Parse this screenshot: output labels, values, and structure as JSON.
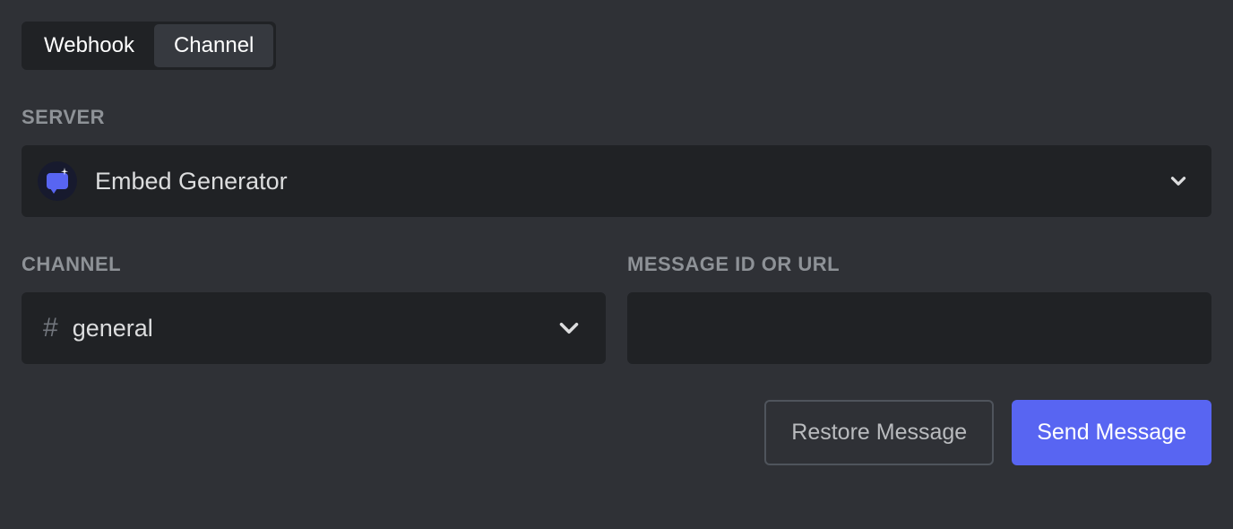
{
  "tabs": {
    "webhook": "Webhook",
    "channel": "Channel"
  },
  "server": {
    "label": "SERVER",
    "selected": "Embed Generator"
  },
  "channel": {
    "label": "CHANNEL",
    "selected": "general"
  },
  "messageId": {
    "label": "MESSAGE ID OR URL",
    "value": ""
  },
  "buttons": {
    "restore": "Restore Message",
    "send": "Send Message"
  }
}
